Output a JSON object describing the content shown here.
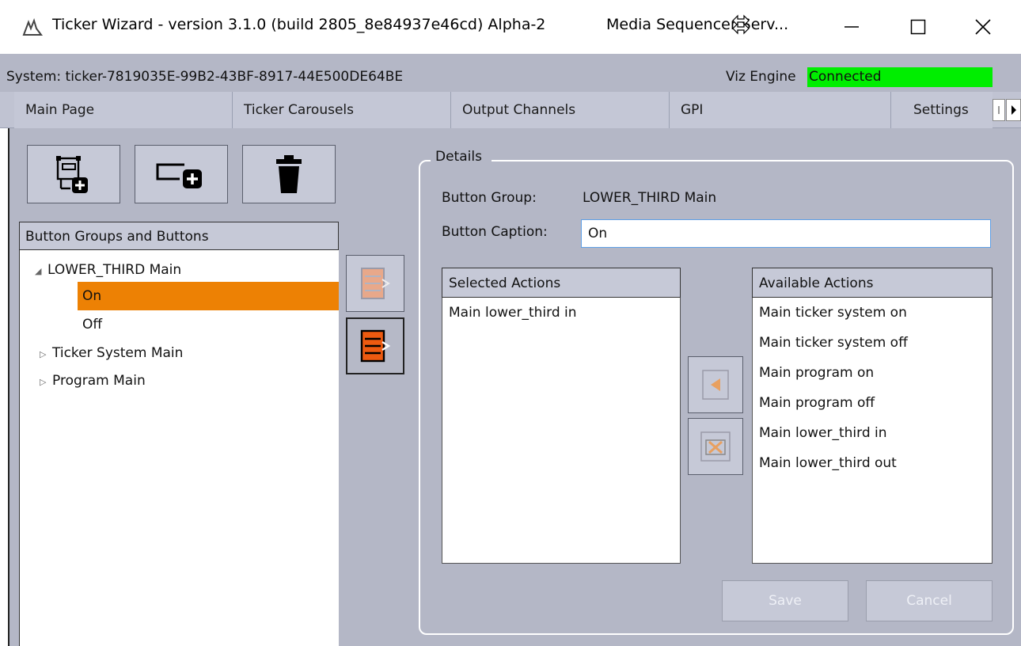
{
  "window": {
    "title": "Ticker Wizard - version 3.1.0 (build 2805_8e84937e46cd) Alpha-2",
    "secondary_title": "Media Sequencer Serv..."
  },
  "status": {
    "system": "System: ticker-7819035E-99B2-43BF-8917-44E500DE64BE",
    "viz_engine_label": "Viz Engine",
    "viz_engine_status": "Connected",
    "status_color": "#00ee00"
  },
  "tabs": [
    {
      "label": "Main Page"
    },
    {
      "label": "Ticker Carousels"
    },
    {
      "label": "Output Channels"
    },
    {
      "label": "GPI"
    },
    {
      "label": "Settings"
    }
  ],
  "tree": {
    "header": "Button Groups and Buttons",
    "groups": [
      {
        "label": "LOWER_THIRD Main",
        "expanded": true,
        "children": [
          {
            "label": "On",
            "selected": true
          },
          {
            "label": "Off"
          }
        ]
      },
      {
        "label": "Ticker System Main",
        "expanded": false
      },
      {
        "label": "Program Main",
        "expanded": false
      }
    ]
  },
  "details": {
    "legend": "Details",
    "button_group_label": "Button Group:",
    "button_group_value": "LOWER_THIRD Main",
    "button_caption_label": "Button Caption:",
    "button_caption_value": "On",
    "selected_actions_header": "Selected Actions",
    "selected_actions": [
      "Main lower_third in"
    ],
    "available_actions_header": "Available Actions",
    "available_actions": [
      "Main ticker system on",
      "Main ticker system off",
      "Main program on",
      "Main program off",
      "Main lower_third in",
      "Main lower_third out"
    ],
    "save_label": "Save",
    "cancel_label": "Cancel"
  },
  "colors": {
    "accent_selected": "#ed8104",
    "panel_bg": "#b4b7c6"
  },
  "icons": {
    "app": "ticker-app-icon",
    "add_group": "add-group-icon",
    "add_button": "add-button-icon",
    "delete": "trash-icon",
    "move_out": "move-out-icon",
    "move_in": "move-in-icon",
    "add_action": "arrow-left-icon",
    "remove_action": "remove-icon"
  }
}
